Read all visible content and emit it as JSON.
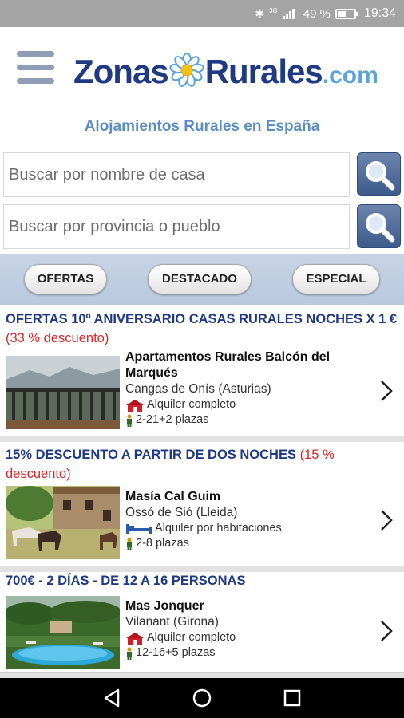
{
  "status_bar": {
    "battery": "49 %",
    "time": "19:34",
    "network": "3G",
    "battery_level": 0.49
  },
  "header": {
    "logo_part1": "Zonas",
    "logo_part2": "Rurales",
    "logo_part3": ".com",
    "menu_icon": "hamburger-icon"
  },
  "subtitle": "Alojamientos Rurales en España",
  "search": {
    "name_placeholder": "Buscar por nombre de casa",
    "province_placeholder": "Buscar por provincia o pueblo",
    "button_icon": "magnifier-icon"
  },
  "tabs": [
    {
      "label": "OFERTAS"
    },
    {
      "label": "DESTACADO"
    },
    {
      "label": "ESPECIAL"
    }
  ],
  "listings": [
    {
      "offer_title": "OFERTAS 10º ANIVERSARIO CASAS RURALES NOCHES X 1 €",
      "offer_discount": "(33 % descuento)",
      "name": "Apartamentos Rurales Balcón del Marqués",
      "location": "Cangas de Onís (Asturias)",
      "rental_type": "Alquiler completo",
      "rental_icon": "house-icon",
      "capacity": "2-21+2 plazas"
    },
    {
      "offer_title": "15% DESCUENTO A PARTIR DE DOS NOCHES",
      "offer_discount": "(15 % descuento)",
      "name": "Masía Cal Guim",
      "location": "Ossó de Sió (Lleida)",
      "rental_type": "Alquiler por habitaciones",
      "rental_icon": "bed-icon",
      "capacity": "2-8 plazas"
    },
    {
      "offer_title": "700€ - 2 DÍAS - DE 12 A 16 PERSONAS",
      "offer_discount": "",
      "name": "Mas Jonquer",
      "location": "Vilanant (Girona)",
      "rental_type": "Alquiler completo",
      "rental_icon": "house-icon",
      "capacity": "12-16+5 plazas"
    }
  ],
  "colors": {
    "brand_dark": "#1f3a83",
    "brand_light": "#5aa3dc",
    "discount_red": "#d42a2a",
    "band": "#c7d4e6"
  }
}
